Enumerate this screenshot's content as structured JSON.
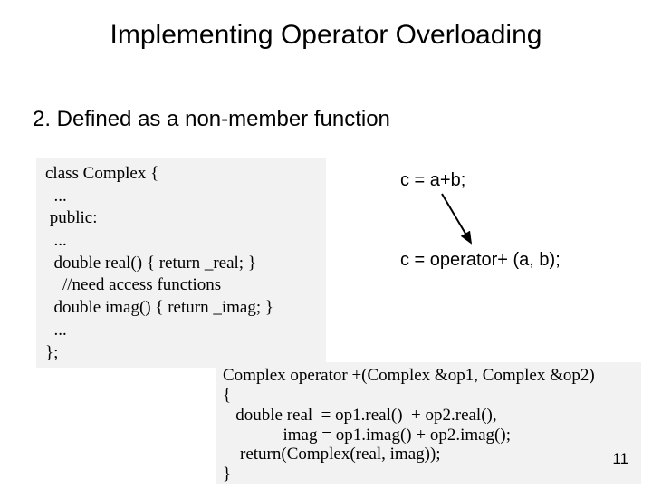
{
  "title": "Implementing Operator Overloading",
  "subheading": "2.  Defined as a non-member function",
  "code_left": "class Complex {\n  ...\n public:\n  ...\n  double real() { return _real; }\n    //need access functions\n  double imag() { return _imag; }\n  ...\n};",
  "eq1": "c = a+b;",
  "eq2": "c = operator+ (a, b);",
  "code_bottom": "Complex operator +(Complex &op1, Complex &op2)\n{\n   double real  = op1.real()  + op2.real(),\n              imag = op1.imag() + op2.imag();\n    return(Complex(real, imag));\n}",
  "page_number": "11"
}
